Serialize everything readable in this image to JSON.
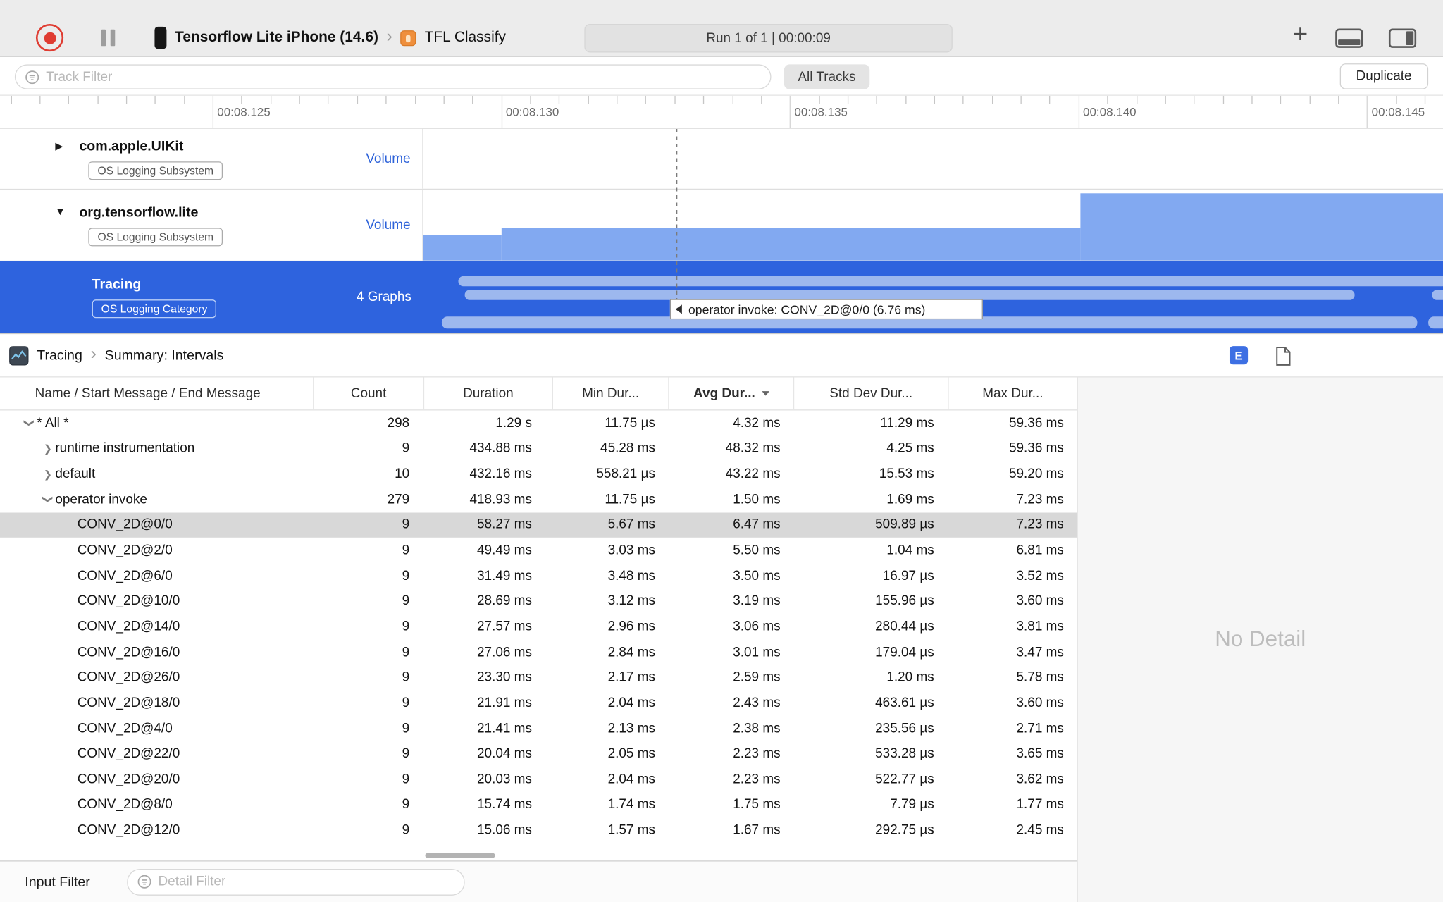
{
  "toolbar": {
    "device_name": "Tensorflow Lite iPhone (14.6)",
    "app_name": "TFL Classify",
    "run_label": "Run 1 of 1  |  00:00:09"
  },
  "filter_bar": {
    "track_filter_placeholder": "Track Filter",
    "all_tracks": "All Tracks",
    "duplicate": "Duplicate"
  },
  "ruler": {
    "labels": [
      "00:08.125",
      "00:08.130",
      "00:08.135",
      "00:08.140",
      "00:08.145"
    ]
  },
  "tracks": {
    "uikit": {
      "name": "com.apple.UIKit",
      "badge": "OS Logging Subsystem",
      "lane": "Volume"
    },
    "tensorflow": {
      "name": "org.tensorflow.lite",
      "badge": "OS Logging Subsystem",
      "lane": "Volume"
    },
    "tracing": {
      "name": "Tracing",
      "badge": "OS Logging Category",
      "lane": "4 Graphs"
    },
    "tooltip": "operator invoke: CONV_2D@0/0 (6.76 ms)"
  },
  "summary": {
    "breadcrumb_instrument": "Tracing",
    "breadcrumb_detail": "Summary: Intervals",
    "expand_button": "E"
  },
  "table": {
    "columns": [
      "Name / Start Message / End Message",
      "Count",
      "Duration",
      "Min Dur...",
      "Avg Dur...",
      "Std Dev Dur...",
      "Max Dur..."
    ],
    "sorted_column": "Avg Dur...",
    "rows": [
      {
        "level": 0,
        "disclosure": "expanded",
        "name": "* All *",
        "count": "298",
        "duration": "1.29 s",
        "min": "11.75 µs",
        "avg": "4.32 ms",
        "std": "11.29 ms",
        "max": "59.36 ms"
      },
      {
        "level": 1,
        "disclosure": "collapsed",
        "name": "runtime instrumentation",
        "count": "9",
        "duration": "434.88 ms",
        "min": "45.28 ms",
        "avg": "48.32 ms",
        "std": "4.25 ms",
        "max": "59.36 ms"
      },
      {
        "level": 1,
        "disclosure": "collapsed",
        "name": "default",
        "count": "10",
        "duration": "432.16 ms",
        "min": "558.21 µs",
        "avg": "43.22 ms",
        "std": "15.53 ms",
        "max": "59.20 ms"
      },
      {
        "level": 1,
        "disclosure": "expanded",
        "name": "operator invoke",
        "count": "279",
        "duration": "418.93 ms",
        "min": "11.75 µs",
        "avg": "1.50 ms",
        "std": "1.69 ms",
        "max": "7.23 ms"
      },
      {
        "level": 2,
        "selected": true,
        "name": "CONV_2D@0/0",
        "count": "9",
        "duration": "58.27 ms",
        "min": "5.67 ms",
        "avg": "6.47 ms",
        "std": "509.89 µs",
        "max": "7.23 ms"
      },
      {
        "level": 2,
        "name": "CONV_2D@2/0",
        "count": "9",
        "duration": "49.49 ms",
        "min": "3.03 ms",
        "avg": "5.50 ms",
        "std": "1.04 ms",
        "max": "6.81 ms"
      },
      {
        "level": 2,
        "name": "CONV_2D@6/0",
        "count": "9",
        "duration": "31.49 ms",
        "min": "3.48 ms",
        "avg": "3.50 ms",
        "std": "16.97 µs",
        "max": "3.52 ms"
      },
      {
        "level": 2,
        "name": "CONV_2D@10/0",
        "count": "9",
        "duration": "28.69 ms",
        "min": "3.12 ms",
        "avg": "3.19 ms",
        "std": "155.96 µs",
        "max": "3.60 ms"
      },
      {
        "level": 2,
        "name": "CONV_2D@14/0",
        "count": "9",
        "duration": "27.57 ms",
        "min": "2.96 ms",
        "avg": "3.06 ms",
        "std": "280.44 µs",
        "max": "3.81 ms"
      },
      {
        "level": 2,
        "name": "CONV_2D@16/0",
        "count": "9",
        "duration": "27.06 ms",
        "min": "2.84 ms",
        "avg": "3.01 ms",
        "std": "179.04 µs",
        "max": "3.47 ms"
      },
      {
        "level": 2,
        "name": "CONV_2D@26/0",
        "count": "9",
        "duration": "23.30 ms",
        "min": "2.17 ms",
        "avg": "2.59 ms",
        "std": "1.20 ms",
        "max": "5.78 ms"
      },
      {
        "level": 2,
        "name": "CONV_2D@18/0",
        "count": "9",
        "duration": "21.91 ms",
        "min": "2.04 ms",
        "avg": "2.43 ms",
        "std": "463.61 µs",
        "max": "3.60 ms"
      },
      {
        "level": 2,
        "name": "CONV_2D@4/0",
        "count": "9",
        "duration": "21.41 ms",
        "min": "2.13 ms",
        "avg": "2.38 ms",
        "std": "235.56 µs",
        "max": "2.71 ms"
      },
      {
        "level": 2,
        "name": "CONV_2D@22/0",
        "count": "9",
        "duration": "20.04 ms",
        "min": "2.05 ms",
        "avg": "2.23 ms",
        "std": "533.28 µs",
        "max": "3.65 ms"
      },
      {
        "level": 2,
        "name": "CONV_2D@20/0",
        "count": "9",
        "duration": "20.03 ms",
        "min": "2.04 ms",
        "avg": "2.23 ms",
        "std": "522.77 µs",
        "max": "3.62 ms"
      },
      {
        "level": 2,
        "name": "CONV_2D@8/0",
        "count": "9",
        "duration": "15.74 ms",
        "min": "1.74 ms",
        "avg": "1.75 ms",
        "std": "7.79 µs",
        "max": "1.77 ms"
      },
      {
        "level": 2,
        "name": "CONV_2D@12/0",
        "count": "9",
        "duration": "15.06 ms",
        "min": "1.57 ms",
        "avg": "1.67 ms",
        "std": "292.75 µs",
        "max": "2.45 ms"
      }
    ]
  },
  "detail_panel": {
    "empty_text": "No Detail"
  },
  "bottom_bar": {
    "input_filter_label": "Input Filter",
    "detail_filter_placeholder": "Detail Filter"
  },
  "colors": {
    "selection_blue": "#2E63DE",
    "track_bar_blue": "#9DB8EE",
    "area_blue": "#82A9F1",
    "accent_blue": "#2D62D9",
    "record_red": "#DF3C32"
  }
}
